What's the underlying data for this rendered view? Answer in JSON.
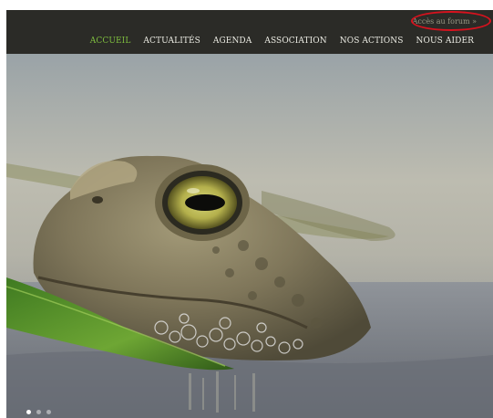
{
  "header": {
    "forum_link": "Accès au forum »",
    "nav": [
      {
        "label": "ACCUEIL",
        "active": true
      },
      {
        "label": "ACTUALITÉS",
        "active": false
      },
      {
        "label": "AGENDA",
        "active": false
      },
      {
        "label": "ASSOCIATION",
        "active": false
      },
      {
        "label": "NOS ACTIONS",
        "active": false
      },
      {
        "label": "NOUS AIDER",
        "active": false
      }
    ]
  },
  "hero": {
    "image": "toad-photo",
    "slides": 3,
    "active_slide": 1
  },
  "colors": {
    "header_bg": "#2b2b27",
    "nav_active": "#7fbf3f",
    "nav_text": "#ecece4",
    "highlight": "#d8121e"
  }
}
